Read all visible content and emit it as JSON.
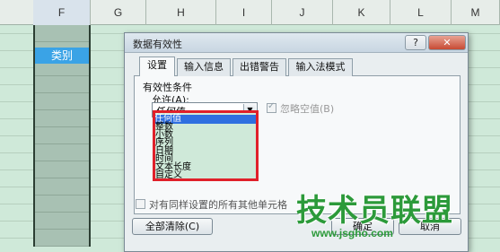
{
  "spreadsheet": {
    "columns": [
      "F",
      "G",
      "H",
      "I",
      "J",
      "K",
      "L",
      "M"
    ],
    "selected_column": "F",
    "category_cell": "类别"
  },
  "dialog": {
    "title": "数据有效性",
    "help_glyph": "?",
    "close_glyph": "✕",
    "tabs": [
      "设置",
      "输入信息",
      "出错警告",
      "输入法模式"
    ],
    "section_label": "有效性条件",
    "allow_label": "允许(A):",
    "allow_value": "任何值",
    "ignore_blank_label": "忽略空值(B)",
    "ignore_blank_checked": true,
    "apply_all_label": "对有同样设置的所有其他单元格",
    "clear_all_button": "全部清除(C)",
    "ok_button": "确定",
    "cancel_button": "取消"
  },
  "dropdown": {
    "options": [
      "任何值",
      "整数",
      "小数",
      "序列",
      "日期",
      "时间",
      "文本长度",
      "自定义"
    ],
    "selected": "任何值",
    "highlight_color": "#e0202a"
  },
  "watermark": {
    "logo_text": "技术员联盟",
    "url": "www.jsgho.com",
    "color": "#2c9a3a"
  }
}
